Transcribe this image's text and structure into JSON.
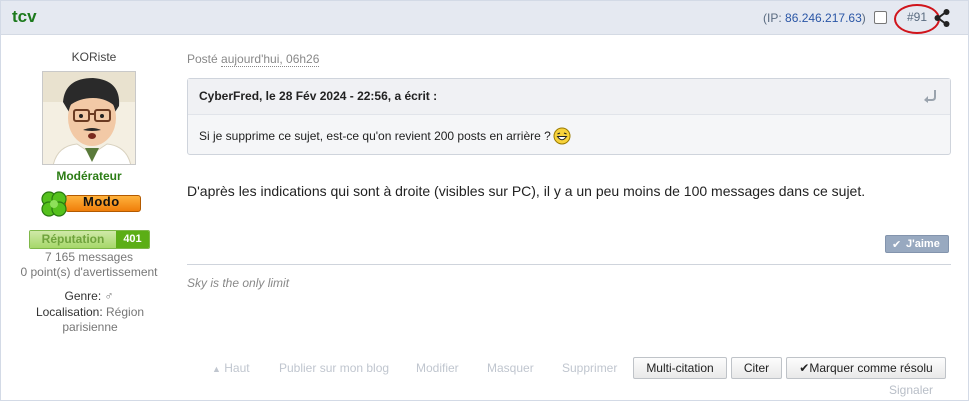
{
  "header": {
    "title": "tcv",
    "ip_prefix": "(IP: ",
    "ip": "86.246.217.63",
    "ip_suffix": ")",
    "post_number": "#91",
    "share_icon": "share-icon"
  },
  "author": {
    "username": "KORiste",
    "rank": "Modérateur",
    "badge": "Modo",
    "reputation_label": "Réputation",
    "reputation_value": "401",
    "messages": "7 165 messages",
    "warnings": "0 point(s) d'avertissement",
    "gender_label": "Genre:",
    "gender_value": "♂",
    "location_label": "Localisation:",
    "location_value": "Région parisienne"
  },
  "post": {
    "posted_prefix": "Posté",
    "posted_when": "aujourd'hui, 06h26",
    "quote_author": "CyberFred, le 28 Fév 2024 - 22:56, a écrit :",
    "quote_text": "Si je supprime ce sujet, est-ce qu'on revient 200 posts en arrière ?",
    "body": "D'après les indications qui sont à droite (visibles sur PC), il y a un peu moins de 100 messages dans ce sujet.",
    "like_label": "J'aime",
    "signature": "Sky is the only limit"
  },
  "actions": {
    "top": "Haut",
    "blog": "Publier sur mon blog",
    "edit": "Modifier",
    "hide": "Masquer",
    "delete": "Supprimer",
    "multiquote": "Multi-citation",
    "quote": "Citer",
    "resolve": "Marquer comme résolu",
    "report": "Signaler"
  },
  "colors": {
    "title": "#1d7a1d",
    "header_bg": "#e5e9f1",
    "rank": "#2c7d15",
    "reputation": "#5cae16",
    "annotation_circle": "#d0141b"
  }
}
